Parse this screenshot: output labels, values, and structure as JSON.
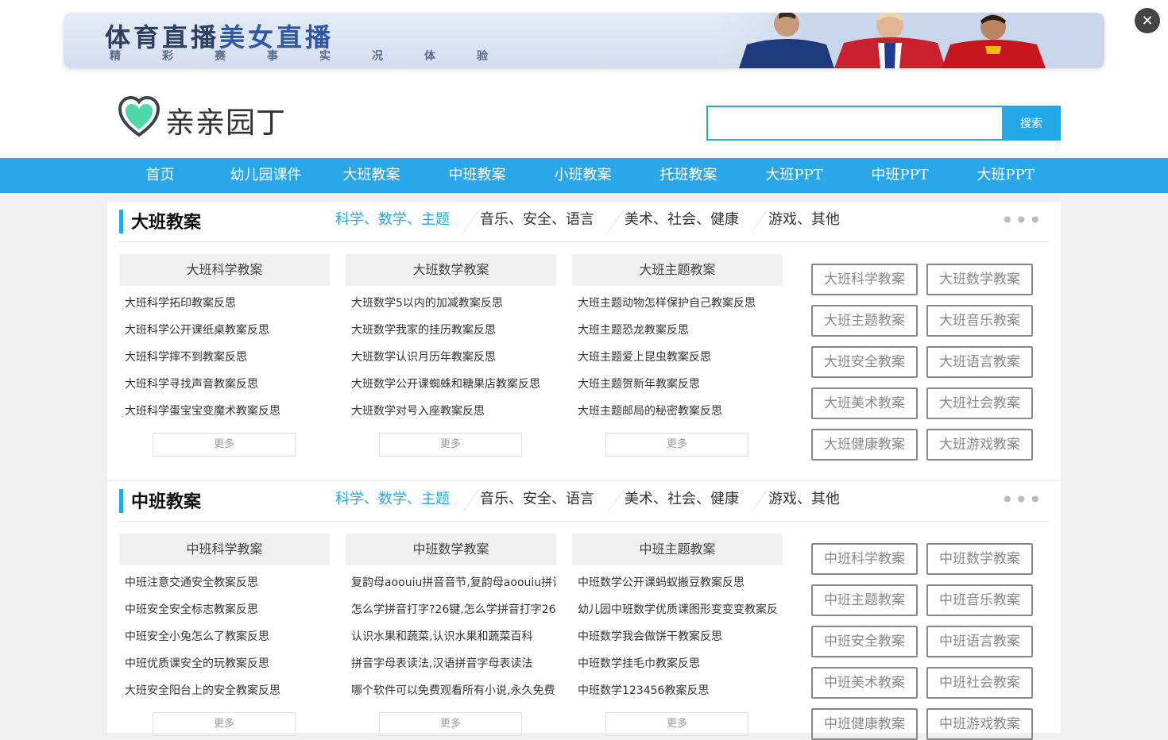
{
  "banner": {
    "title_part1": "体育直播",
    "title_part2": "美女直播",
    "subtitle": "精彩赛事实况体验"
  },
  "close_label": "✕",
  "logo": {
    "text": "亲亲园丁"
  },
  "search": {
    "value": "",
    "placeholder": "",
    "button_label": "搜索"
  },
  "nav": {
    "items": [
      "首页",
      "幼儿园课件",
      "大班教案",
      "中班教案",
      "小班教案",
      "托班教案",
      "大班PPT",
      "中班PPT",
      "大班PPT"
    ]
  },
  "colors": {
    "accent": "#22a8e8",
    "nav_bg": "#2aa7e8"
  },
  "sections": [
    {
      "title": "大班教案",
      "tabs": [
        "科学、数学、主题",
        "音乐、安全、语言",
        "美术、社会、健康",
        "游戏、其他"
      ],
      "columns": [
        {
          "title": "大班科学教案",
          "items": [
            "大班科学拓印教案反思",
            "大班科学公开课纸桌教案反思",
            "大班科学摔不到教案反思",
            "大班科学寻找声音教案反思",
            "大班科学蛋宝宝变魔术教案反思"
          ],
          "more": "更多"
        },
        {
          "title": "大班数学教案",
          "items": [
            "大班数学5以内的加减教案反思",
            "大班数学我家的挂历教案反思",
            "大班数学认识月历年教案反思",
            "大班数学公开课蜘蛛和糖果店教案反思",
            "大班数学对号入座教案反思"
          ],
          "more": "更多"
        },
        {
          "title": "大班主题教案",
          "items": [
            "大班主题动物怎样保护自己教案反思",
            "大班主题恐龙教案反思",
            "大班主题爱上昆虫教案反思",
            "大班主题贺新年教案反思",
            "大班主题邮局的秘密教案反思"
          ],
          "more": "更多"
        }
      ],
      "tags": [
        "大班科学教案",
        "大班数学教案",
        "大班主题教案",
        "大班音乐教案",
        "大班安全教案",
        "大班语言教案",
        "大班美术教案",
        "大班社会教案",
        "大班健康教案",
        "大班游戏教案"
      ]
    },
    {
      "title": "中班教案",
      "tabs": [
        "科学、数学、主题",
        "音乐、安全、语言",
        "美术、社会、健康",
        "游戏、其他"
      ],
      "columns": [
        {
          "title": "中班科学教案",
          "items": [
            "中班注意交通安全教案反思",
            "中班安全安全标志教案反思",
            "中班安全小兔怎么了教案反思",
            "中班优质课安全的玩教案反思",
            "大班安全阳台上的安全教案反思"
          ],
          "more": "更多"
        },
        {
          "title": "中班数学教案",
          "items": [
            "复韵母aoouiu拼音音节,复韵母aoouiu拼读",
            "怎么学拼音打字?26键,怎么学拼音打字26",
            "认识水果和蔬菜,认识水果和蔬菜百科",
            "拼音字母表读法,汉语拼音字母表读法",
            "哪个软件可以免费观看所有小说,永久免费"
          ],
          "more": "更多"
        },
        {
          "title": "中班主题教案",
          "items": [
            "中班数学公开课蚂蚁搬豆教案反思",
            "幼儿园中班数学优质课图形变变变教案反",
            "中班数学我会做饼干教案反思",
            "中班数学挂毛巾教案反思",
            "中班数学123456教案反思"
          ],
          "more": "更多"
        }
      ],
      "tags": [
        "中班科学教案",
        "中班数学教案",
        "中班主题教案",
        "中班音乐教案",
        "中班安全教案",
        "中班语言教案",
        "中班美术教案",
        "中班社会教案",
        "中班健康教案",
        "中班游戏教案"
      ]
    }
  ]
}
